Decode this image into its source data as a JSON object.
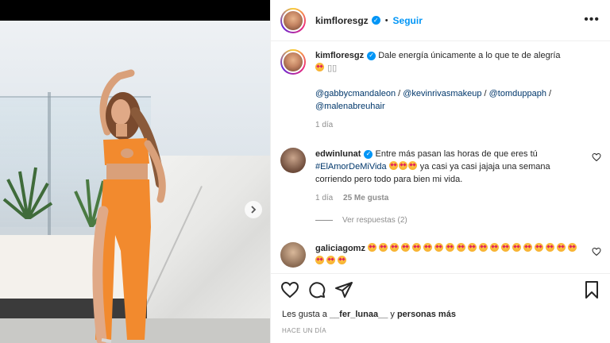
{
  "post": {
    "username": "kimfloresgz",
    "follow_label": "Seguir",
    "dot": "•",
    "more_label": "•••"
  },
  "caption": {
    "username": "kimfloresgz",
    "text": "Dale energía únicamente a lo que te de alegría",
    "mentions": [
      "@gabbycmandaleon",
      "@kevinrivasmakeup",
      "@tomduppaph",
      "@malenabreuhair"
    ],
    "separator": " / ",
    "time": "1 día"
  },
  "comments": [
    {
      "username": "edwinlunat",
      "text_1": "Entre más pasan las horas de que eres tú",
      "hashtag": "#ElAmorDeMiVida",
      "text_2": "ya casi ya casi jajaja una semana corriendo pero todo para bien mi vida.",
      "time": "1 día",
      "likes": "25 Me gusta",
      "replies_label": "Ver respuestas (2)"
    },
    {
      "username": "galiciagomz",
      "emoji_count": 22
    }
  ],
  "likes": {
    "prefix": "Les gusta a",
    "user": "__fer_lunaa__",
    "middle": "y",
    "suffix": "personas más"
  },
  "time_ago": "HACE UN DÍA",
  "icons": {
    "like": "heart-icon",
    "comment": "comment-icon",
    "share": "share-icon",
    "save": "bookmark-icon",
    "next": "chevron-right-icon"
  },
  "colors": {
    "accent": "#0095f6",
    "dress": "#f28a2e"
  }
}
